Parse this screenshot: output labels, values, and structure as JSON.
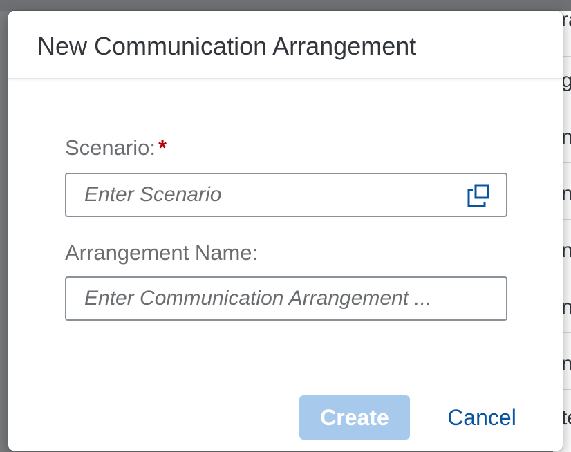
{
  "background": {
    "row_fragments": [
      "ra",
      "g",
      "na",
      "na",
      "na",
      "na",
      "na",
      "te"
    ]
  },
  "dialog": {
    "title": "New Communication Arrangement",
    "fields": {
      "scenario": {
        "label": "Scenario:",
        "required_marker": "*",
        "placeholder": "Enter Scenario",
        "value": "",
        "value_help_icon": "value-help-icon"
      },
      "arrangement_name": {
        "label": "Arrangement Name:",
        "placeholder": "Enter Communication Arrangement ...",
        "value": ""
      }
    },
    "footer": {
      "create_label": "Create",
      "cancel_label": "Cancel"
    }
  },
  "colors": {
    "accent": "#0854a0",
    "create_disabled_bg": "#a7c9ec",
    "required": "#bb0000"
  }
}
